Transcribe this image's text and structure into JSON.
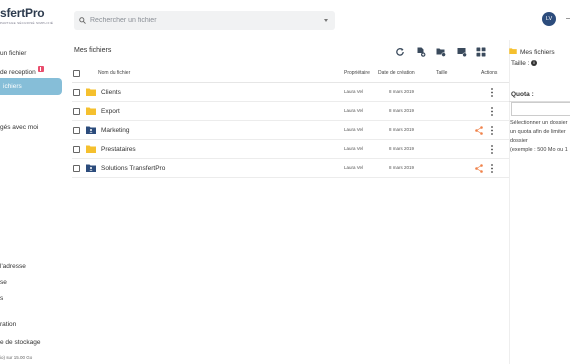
{
  "logo": {
    "text": "sfertPro",
    "tagline": "PARTAGE SÉCURISÉ SIMPLIFIÉ"
  },
  "sidebar": {
    "items": [
      {
        "label": "un fichier"
      },
      {
        "label": "de reception",
        "badge": true
      },
      {
        "label": "ichiers",
        "active": true
      },
      {
        "label": "gés avec moi"
      }
    ],
    "bottom": [
      {
        "label": "l'adresse"
      },
      {
        "label": "se"
      },
      {
        "label": "s"
      },
      {
        "label": "ration"
      },
      {
        "label": "e de stockage"
      }
    ],
    "storage_text": "io) sur 15.00 Go"
  },
  "search": {
    "placeholder": "Rechercher un fichier"
  },
  "user": {
    "initials": "LV"
  },
  "main": {
    "title": "Mes fichiers",
    "toolbar_icons": [
      "refresh-icon",
      "upload-file-icon",
      "new-folder-icon",
      "import-icon",
      "grid-view-icon"
    ],
    "columns": {
      "name": "Nom du fichier",
      "owner": "Propriétaire",
      "date": "Date de création",
      "size": "Taille",
      "actions": "Actions"
    },
    "rows": [
      {
        "name": "Clients",
        "owner": "Laura Vel",
        "date": "8 mars 2019",
        "type": "folder",
        "shared": false
      },
      {
        "name": "Export",
        "owner": "Laura Vel",
        "date": "8 mars 2019",
        "type": "folder",
        "shared": false
      },
      {
        "name": "Marketing",
        "owner": "Laura Vel",
        "date": "8 mars 2019",
        "type": "shared-folder",
        "shared": true
      },
      {
        "name": "Prestataires",
        "owner": "Laura Vel",
        "date": "8 mars 2019",
        "type": "folder",
        "shared": false
      },
      {
        "name": "Solutions TransfertPro",
        "owner": "Laura Vel",
        "date": "8 mars 2019",
        "type": "shared-folder",
        "shared": true
      }
    ]
  },
  "details": {
    "title": "Mes fichiers",
    "size_label": "Taille :",
    "quota_label": "Quota :",
    "help_lines": [
      "Sélectionner un dossier",
      "un quota afin de limiter",
      "dossier",
      "(exemple : 500 Mo ou 1"
    ]
  },
  "colors": {
    "accent": "#86bed8",
    "folder": "#f5c02e",
    "shared_folder": "#2c4c7c",
    "share": "#f0824a",
    "badge": "#e94e6d",
    "avatar": "#2c4c7c"
  }
}
